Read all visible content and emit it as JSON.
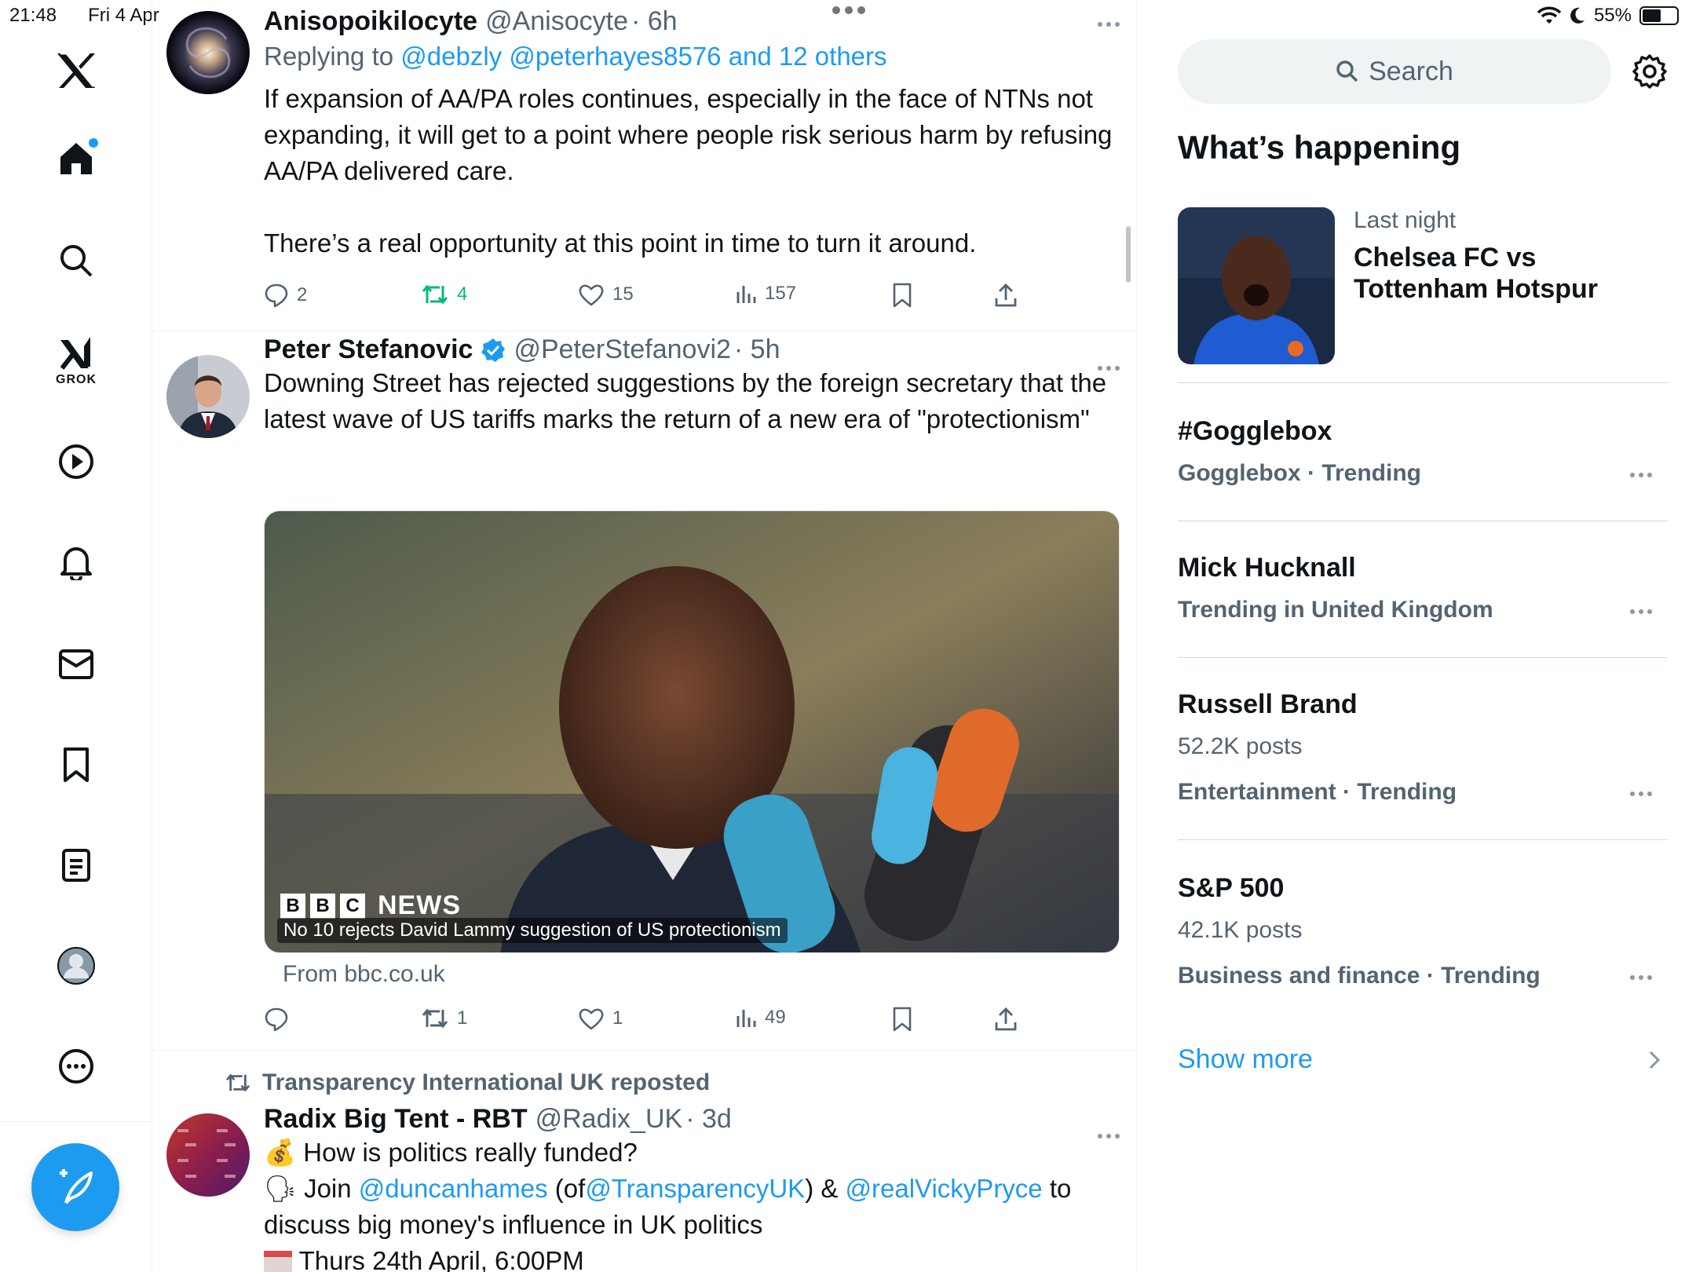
{
  "status_bar": {
    "time": "21:48",
    "date": "Fri 4 Apr",
    "battery": "55%",
    "battery_level": 0.55
  },
  "nav": {
    "grok_label": "GROK"
  },
  "tweets": [
    {
      "name": "Anisopoikilocyte",
      "handle": "@Anisocyte",
      "time": "· 6h",
      "reply_prefix": "Replying to",
      "reply_users": "@debzly @peterhayes8576",
      "reply_others": "and 12 others",
      "text_1": "If expansion of AA/PA roles continues, especially in the face of NTNs not expanding, it will get to a point where people risk serious harm by refusing AA/PA delivered care.",
      "text_2": "There’s a real opportunity at this point in time to turn it around.",
      "replies": "2",
      "reposts": "4",
      "likes": "15",
      "views": "157"
    },
    {
      "name": "Peter Stefanovic",
      "handle": "@PeterStefanovi2",
      "time": "· 5h",
      "text": "Downing Street has rejected suggestions by the foreign secretary that the latest wave of US tariffs marks the return of a new era of \"protectionism\"",
      "media_caption": "No 10 rejects David Lammy suggestion of US protectionism",
      "media_brand": "NEWS",
      "media_source": "From bbc.co.uk",
      "replies": "",
      "reposts": "1",
      "likes": "1",
      "views": "49"
    },
    {
      "repost_by": "Transparency International UK reposted",
      "name": "Radix Big Tent - RBT",
      "handle": "@Radix_UK",
      "time": "· 3d",
      "line_1_emoji": "💰",
      "line_1": "How is politics really funded?",
      "line_2_emoji": "🗣",
      "line_2_pre": "Join",
      "mention_1": "@duncanhames",
      "line_2_mid": "(of",
      "mention_2": "@TransparencyUK",
      "line_2_amp": ") &",
      "mention_3": "@realVickyPryce",
      "line_2_post": "to",
      "line_3": "discuss big money's influence in UK politics",
      "line_4": "Thurs 24th April, 6:00PM"
    }
  ],
  "sidebar": {
    "search_placeholder": "Search",
    "heading": "What’s happening",
    "featured": {
      "meta": "Last night",
      "title": "Chelsea FC vs Tottenham Hotspur"
    },
    "trends": [
      {
        "title": "#Gogglebox",
        "sub": "Gogglebox · Trending"
      },
      {
        "title": "Mick Hucknall",
        "sub": "Trending in United Kingdom"
      },
      {
        "title": "Russell Brand",
        "posts": "52.2K posts",
        "sub": "Entertainment · Trending"
      },
      {
        "title": "S&P 500",
        "posts": "42.1K posts",
        "sub": "Business and finance · Trending"
      }
    ],
    "show_more": "Show more"
  },
  "colors": {
    "accent": "#1d9bf0",
    "repost_active": "#00ba7c",
    "secondary_text": "#536471"
  }
}
